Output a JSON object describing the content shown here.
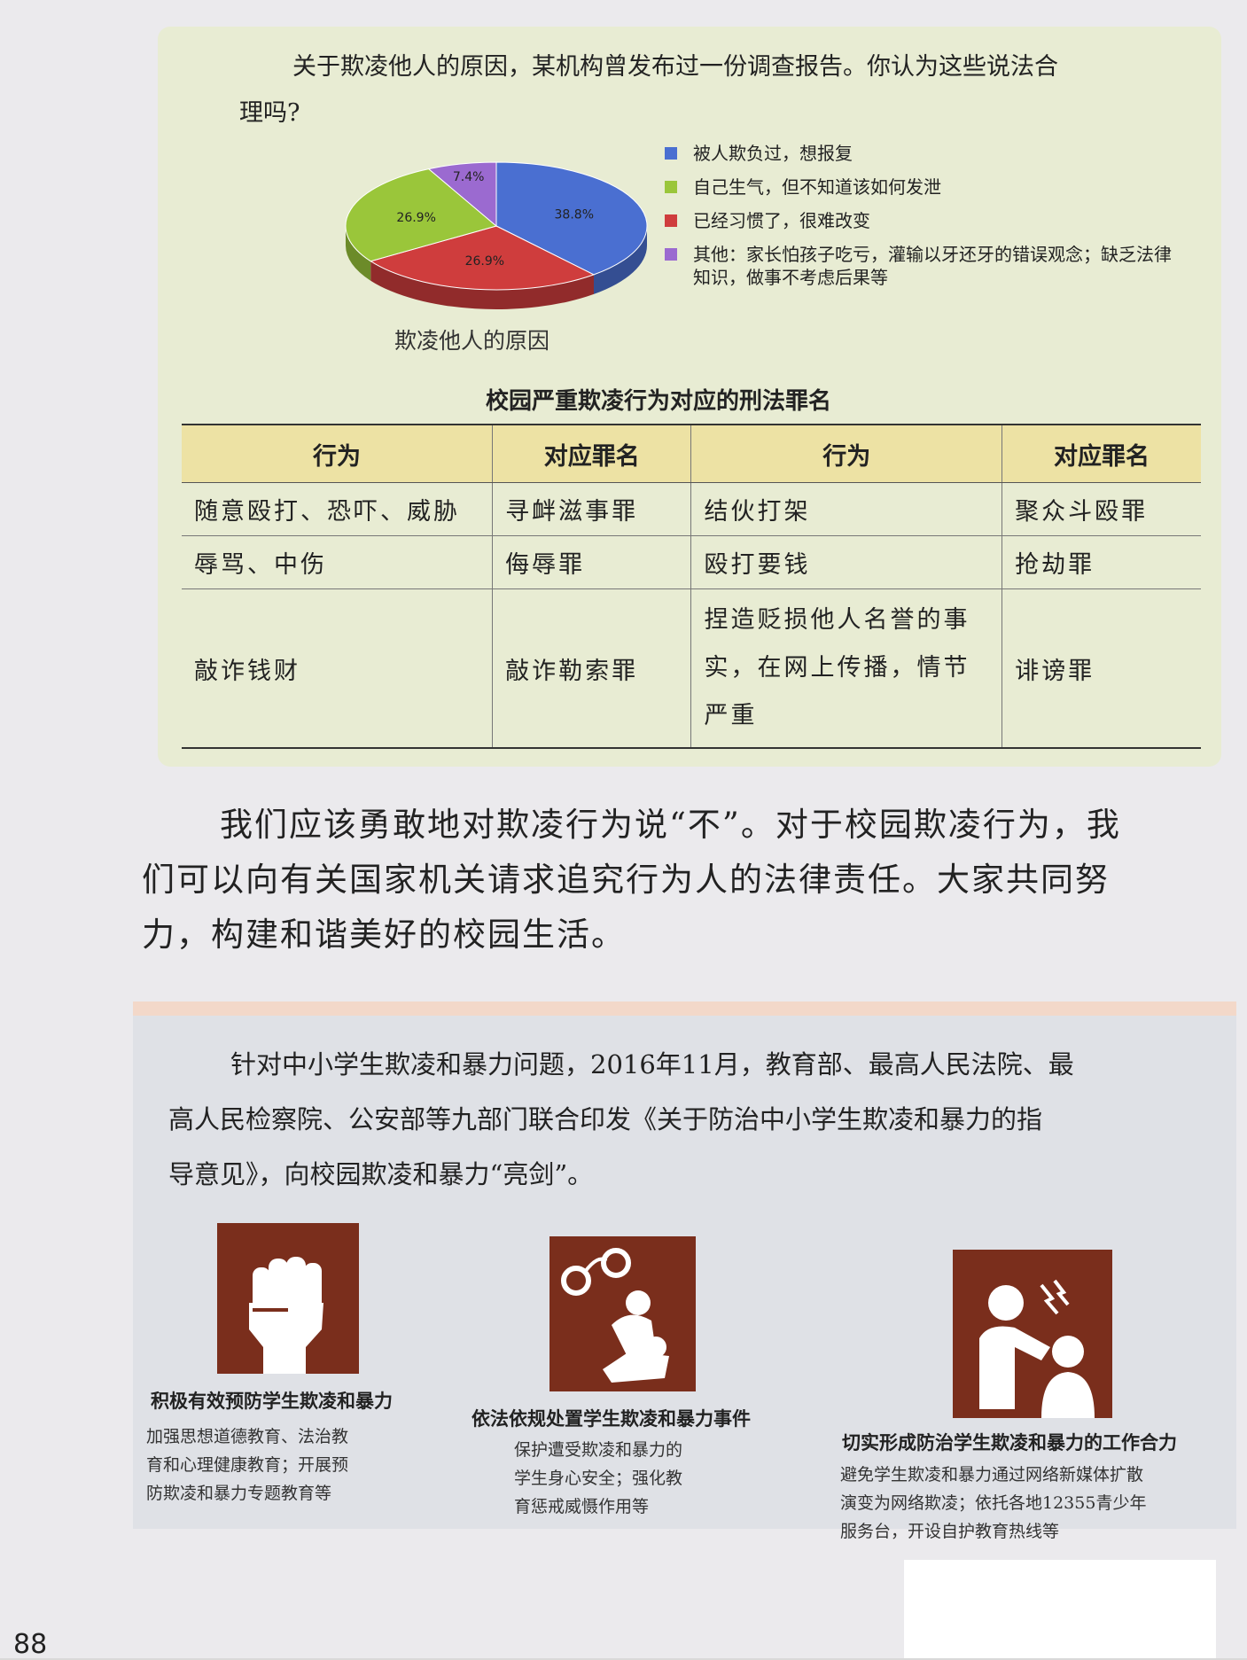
{
  "intro": {
    "line1": "关于欺凌他人的原因，某机构曾发布过一份调查报告。你认为这些说法合",
    "line2": "理吗?"
  },
  "chart_data": {
    "type": "pie",
    "title": "欺凌他人的原因",
    "slices": [
      {
        "label": "被人欺负过，想报复",
        "value": 38.8,
        "value_label": "38.8%",
        "color": "#4a6fd1"
      },
      {
        "label": "已经习惯了，很难改变",
        "value": 26.9,
        "value_label": "26.9%",
        "color": "#cf3d3d"
      },
      {
        "label": "自己生气，但不知道该如何发泄",
        "value": 26.9,
        "value_label": "26.9%",
        "color": "#9ac63a"
      },
      {
        "label": "其他：家长怕孩子吃亏，灌输以牙还牙的错误观念；缺乏法律知识，做事不考虑后果等",
        "value": 7.4,
        "value_label": "7.4%",
        "color": "#9b6ad0"
      }
    ],
    "legend_order": [
      {
        "label": "被人欺负过，想报复",
        "color": "#4a6fd1"
      },
      {
        "label": "自己生气，但不知道该如何发泄",
        "color": "#9ac63a"
      },
      {
        "label": "已经习惯了，很难改变",
        "color": "#cf3d3d"
      },
      {
        "label": "其他：家长怕孩子吃亏，灌输以牙还牙的错误观念；缺乏法律知识，做事不考虑后果等",
        "color": "#9b6ad0"
      }
    ],
    "legend_placement": "right"
  },
  "table": {
    "title": "校园严重欺凌行为对应的刑法罪名",
    "headers": [
      "行为",
      "对应罪名",
      "行为",
      "对应罪名"
    ],
    "rows": [
      [
        "随意殴打、恐吓、威胁",
        "寻衅滋事罪",
        "结伙打架",
        "聚众斗殴罪"
      ],
      [
        "辱骂、中伤",
        "侮辱罪",
        "殴打要钱",
        "抢劫罪"
      ],
      [
        "敲诈钱财",
        "敲诈勒索罪",
        "捏造贬损他人名誉的事实，在网上传播，情节严重",
        "诽谤罪"
      ]
    ]
  },
  "paragraph": {
    "line1": "我们应该勇敢地对欺凌行为说“不”。对于校园欺凌行为，我",
    "line2": "们可以向有关国家机关请求追究行为人的法律责任。大家共同努",
    "line3": "力，构建和谐美好的校园生活。"
  },
  "bottom": {
    "line1": "针对中小学生欺凌和暴力问题，2016年11月，教育部、最高人民法院、最",
    "line2": "高人民检察院、公安部等九部门联合印发《关于防治中小学生欺凌和暴力的指",
    "line3": "导意见》，向校园欺凌和暴力“亮剑”。"
  },
  "icons": [
    {
      "icon": "raised-fist-icon",
      "title": "积极有效预防学生欺凌和暴力",
      "desc": [
        "加强思想道德教育、法治教",
        "育和心理健康教育；开展预",
        "防欺凌和暴力专题教育等"
      ]
    },
    {
      "icon": "handcuffs-arrest-icon",
      "title": "依法依规处置学生欺凌和暴力事件",
      "desc": [
        "保护遭受欺凌和暴力的",
        "学生身心安全；强化教",
        "育惩戒威慑作用等"
      ]
    },
    {
      "icon": "protect-people-icon",
      "title": "切实形成防治学生欺凌和暴力的工作合力",
      "desc": [
        "避免学生欺凌和暴力通过网络新媒体扩散",
        "演变为网络欺凌；依托各地12355青少年",
        "服务台，开设自护教育热线等"
      ]
    }
  ],
  "page_number": "88"
}
